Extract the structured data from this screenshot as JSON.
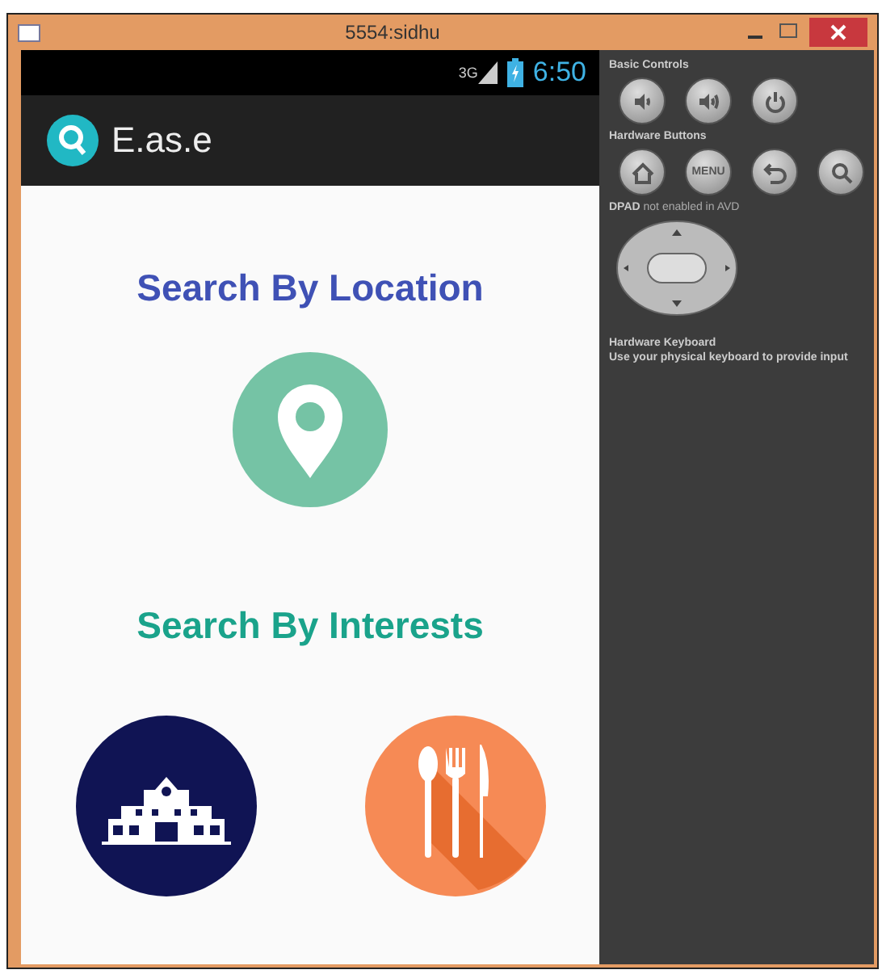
{
  "window": {
    "title": "5554:sidhu"
  },
  "status_bar": {
    "network": "3G",
    "time": "6:50"
  },
  "action_bar": {
    "title": "E.as.e"
  },
  "content": {
    "location_heading": "Search By Location",
    "interests_heading": "Search By Interests"
  },
  "controls": {
    "basic_label": "Basic Controls",
    "hardware_label": "Hardware Buttons",
    "menu_key": "MENU",
    "dpad_note": "**DPAD** not enabled in AVD",
    "keyboard_label": "Hardware Keyboard",
    "keyboard_note": "Use your physical keyboard to provide input"
  }
}
